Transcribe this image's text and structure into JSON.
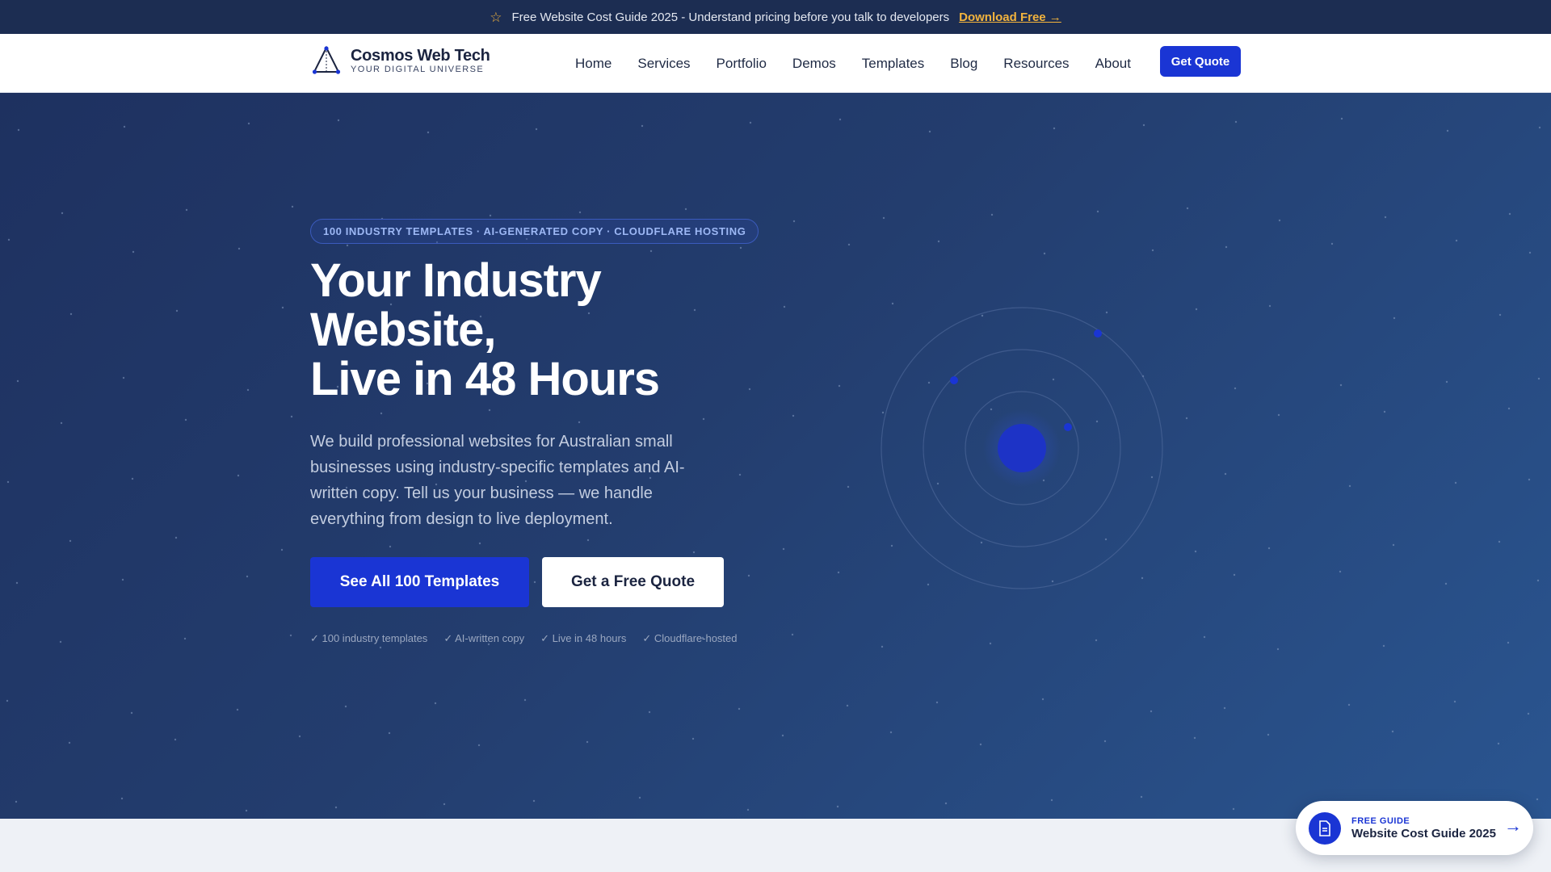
{
  "announcement": {
    "text": "Free Website Cost Guide 2025 - Understand pricing before you talk to developers",
    "link": "Download Free →",
    "icon": "star-icon"
  },
  "header": {
    "brand_name": "Cosmos Web Tech",
    "brand_tagline": "YOUR DIGITAL UNIVERSE",
    "logo_icon": "triangle-logo-icon",
    "nav": [
      "Home",
      "Services",
      "Portfolio",
      "Demos",
      "Templates",
      "Blog",
      "Resources",
      "About"
    ],
    "cta": "Get Quote"
  },
  "hero": {
    "pill": "100 INDUSTRY TEMPLATES · AI-GENERATED COPY · CLOUDFLARE HOSTING",
    "title_line1": "Your Industry",
    "title_line2": "Website,",
    "title_line3": "Live in 48 Hours",
    "subtitle": "We build professional websites for Australian small businesses using industry-specific templates and AI-written copy. Tell us your business — we handle everything from design to live deployment.",
    "primary_button": "See All 100 Templates",
    "secondary_button": "Get a Free Quote",
    "checks": [
      "✓ 100 industry templates",
      "✓ AI-written copy",
      "✓ Live in 48 hours",
      "✓ Cloudflare-hosted"
    ]
  },
  "guide_card": {
    "eyebrow": "FREE GUIDE",
    "title": "Website Cost Guide 2025",
    "arrow": "→",
    "icon": "document-icon"
  },
  "colors": {
    "accent": "#1a35d4",
    "announce_bg": "#1c2d52",
    "highlight": "#f2b33d",
    "hero_bg": "#233d6e"
  }
}
